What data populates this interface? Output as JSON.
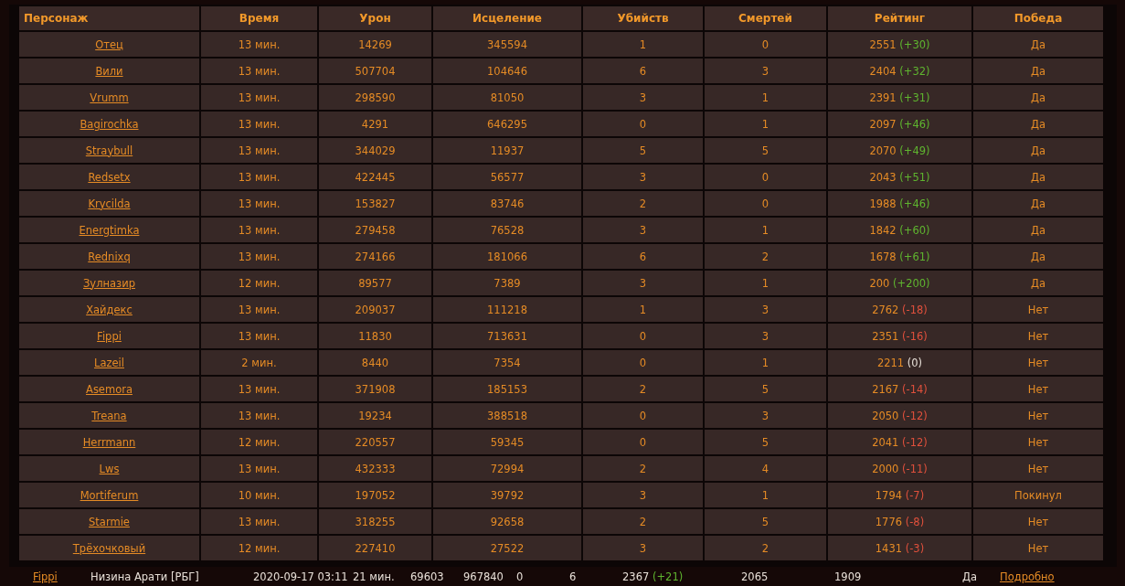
{
  "table": {
    "columns": [
      "Персонаж",
      "Время",
      "Урон",
      "Исцеление",
      "Убийств",
      "Смертей",
      "Рейтинг",
      "Победа"
    ],
    "rows": [
      {
        "name": "Отец",
        "time": "13 мин.",
        "damage": "14269",
        "healing": "345594",
        "kills": "1",
        "deaths": "0",
        "rating": "2551",
        "delta": "(+30)",
        "color": "#5fb52f",
        "result": "Да"
      },
      {
        "name": "Вили",
        "time": "13 мин.",
        "damage": "507704",
        "healing": "104646",
        "kills": "6",
        "deaths": "3",
        "rating": "2404",
        "delta": "(+32)",
        "color": "#5fb52f",
        "result": "Да"
      },
      {
        "name": "Vrumm",
        "time": "13 мин.",
        "damage": "298590",
        "healing": "81050",
        "kills": "3",
        "deaths": "1",
        "rating": "2391",
        "delta": "(+31)",
        "color": "#5fb52f",
        "result": "Да"
      },
      {
        "name": "Bagirochka",
        "time": "13 мин.",
        "damage": "4291",
        "healing": "646295",
        "kills": "0",
        "deaths": "1",
        "rating": "2097",
        "delta": "(+46)",
        "color": "#5fb52f",
        "result": "Да"
      },
      {
        "name": "Straybull",
        "time": "13 мин.",
        "damage": "344029",
        "healing": "11937",
        "kills": "5",
        "deaths": "5",
        "rating": "2070",
        "delta": "(+49)",
        "color": "#5fb52f",
        "result": "Да"
      },
      {
        "name": "Redsetx",
        "time": "13 мин.",
        "damage": "422445",
        "healing": "56577",
        "kills": "3",
        "deaths": "0",
        "rating": "2043",
        "delta": "(+51)",
        "color": "#5fb52f",
        "result": "Да"
      },
      {
        "name": "Krycilda",
        "time": "13 мин.",
        "damage": "153827",
        "healing": "83746",
        "kills": "2",
        "deaths": "0",
        "rating": "1988",
        "delta": "(+46)",
        "color": "#5fb52f",
        "result": "Да"
      },
      {
        "name": "Energtimka",
        "time": "13 мин.",
        "damage": "279458",
        "healing": "76528",
        "kills": "3",
        "deaths": "1",
        "rating": "1842",
        "delta": "(+60)",
        "color": "#5fb52f",
        "result": "Да"
      },
      {
        "name": "Rednixq",
        "time": "13 мин.",
        "damage": "274166",
        "healing": "181066",
        "kills": "6",
        "deaths": "2",
        "rating": "1678",
        "delta": "(+61)",
        "color": "#5fb52f",
        "result": "Да"
      },
      {
        "name": "Зулназир",
        "time": "12 мин.",
        "damage": "89577",
        "healing": "7389",
        "kills": "3",
        "deaths": "1",
        "rating": "200",
        "delta": "(+200)",
        "color": "#5fb52f",
        "result": "Да"
      },
      {
        "name": "Хайдекс",
        "time": "13 мин.",
        "damage": "209037",
        "healing": "111218",
        "kills": "1",
        "deaths": "3",
        "rating": "2762",
        "delta": "(-18)",
        "color": "#e0503c",
        "result": "Нет"
      },
      {
        "name": "Fippi",
        "time": "13 мин.",
        "damage": "11830",
        "healing": "713631",
        "kills": "0",
        "deaths": "3",
        "rating": "2351",
        "delta": "(-16)",
        "color": "#e0503c",
        "result": "Нет"
      },
      {
        "name": "Lazeil",
        "time": "2 мин.",
        "damage": "8440",
        "healing": "7354",
        "kills": "0",
        "deaths": "1",
        "rating": "2211",
        "delta": "(0)",
        "color": "#e8e0d8",
        "result": "Нет"
      },
      {
        "name": "Asemora",
        "time": "13 мин.",
        "damage": "371908",
        "healing": "185153",
        "kills": "2",
        "deaths": "5",
        "rating": "2167",
        "delta": "(-14)",
        "color": "#e0503c",
        "result": "Нет"
      },
      {
        "name": "Treana",
        "time": "13 мин.",
        "damage": "19234",
        "healing": "388518",
        "kills": "0",
        "deaths": "3",
        "rating": "2050",
        "delta": "(-12)",
        "color": "#e0503c",
        "result": "Нет"
      },
      {
        "name": "Herrmann",
        "time": "12 мин.",
        "damage": "220557",
        "healing": "59345",
        "kills": "0",
        "deaths": "5",
        "rating": "2041",
        "delta": "(-12)",
        "color": "#e0503c",
        "result": "Нет"
      },
      {
        "name": "Lws",
        "time": "13 мин.",
        "damage": "432333",
        "healing": "72994",
        "kills": "2",
        "deaths": "4",
        "rating": "2000",
        "delta": "(-11)",
        "color": "#e0503c",
        "result": "Нет"
      },
      {
        "name": "Mortiferum",
        "time": "10 мин.",
        "damage": "197052",
        "healing": "39792",
        "kills": "3",
        "deaths": "1",
        "rating": "1794",
        "delta": "(-7)",
        "color": "#e0503c",
        "result": "Покинул"
      },
      {
        "name": "Starmie",
        "time": "13 мин.",
        "damage": "318255",
        "healing": "92658",
        "kills": "2",
        "deaths": "5",
        "rating": "1776",
        "delta": "(-8)",
        "color": "#e0503c",
        "result": "Нет"
      },
      {
        "name": "Трёхочковый",
        "time": "12 мин.",
        "damage": "227410",
        "healing": "27522",
        "kills": "3",
        "deaths": "2",
        "rating": "1431",
        "delta": "(-3)",
        "color": "#e0503c",
        "result": "Нет"
      }
    ]
  },
  "match_row": {
    "player": "Fippi",
    "map": "Низина Арати [РБГ]",
    "date": "2020-09-17 03:11",
    "duration": "21 мин.",
    "damage": "69603",
    "healing": "967840",
    "kills": "0",
    "deaths": "6",
    "rating": "2367",
    "delta": "(+21)",
    "color": "#5fb52f",
    "mmr_a": "2065",
    "mmr_b": "1909",
    "result": "Да",
    "details": "Подробно"
  }
}
